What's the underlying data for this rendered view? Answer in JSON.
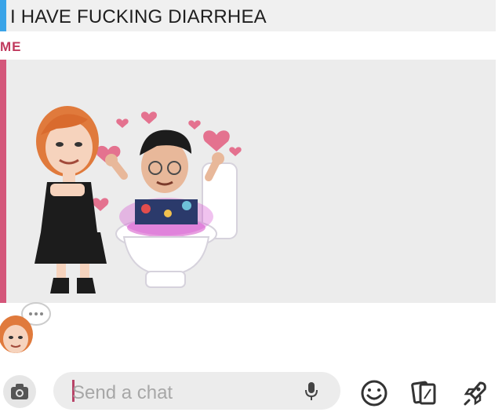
{
  "message": {
    "text": "I HAVE FUCKING DIARRHEA"
  },
  "sender": {
    "label": "ME"
  },
  "chat_input": {
    "placeholder": "Send a chat"
  },
  "icons": {
    "camera": "camera-icon",
    "microphone": "microphone-icon",
    "smiley": "smiley-icon",
    "stickers": "sticker-cards-icon",
    "rocket": "rocket-icon",
    "typing": "typing-bubble-icon"
  },
  "colors": {
    "message_accent": "#3aa4e8",
    "sender_color": "#c0395d",
    "bitmoji_accent": "#d4567a",
    "caret": "#b84468"
  }
}
